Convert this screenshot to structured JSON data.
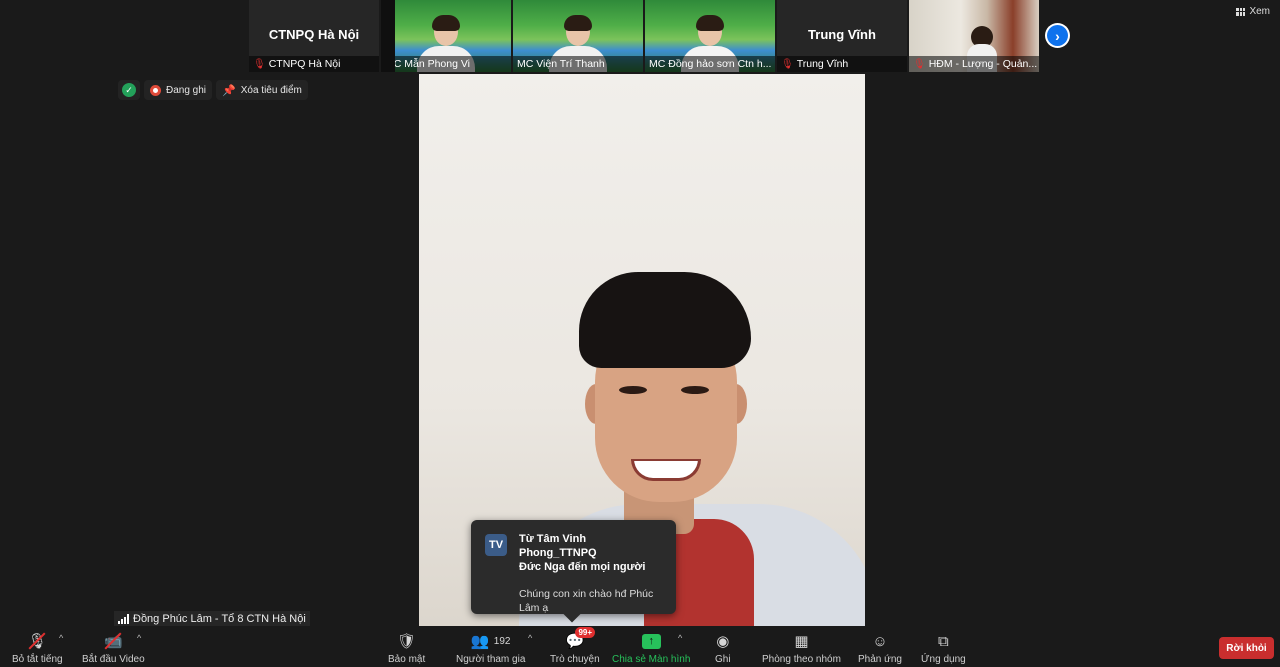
{
  "gallery": {
    "tiles": [
      {
        "type": "name",
        "big_name": "CTNPQ Hà Nội",
        "caption": "CTNPQ Hà Nội",
        "muted": true
      },
      {
        "type": "video",
        "caption": "MC Mẫn Phong Vi",
        "muted": false
      },
      {
        "type": "video",
        "caption": "MC Viện Trí Thanh",
        "muted": false
      },
      {
        "type": "video",
        "caption": "MC Đồng hảo sơn Ctn h...",
        "muted": false
      },
      {
        "type": "name",
        "big_name": "Trung Vĩnh",
        "caption": "Trung Vĩnh",
        "muted": true
      },
      {
        "type": "room",
        "caption": "HĐM - Lượng - Quản...",
        "muted": true
      }
    ],
    "next_icon": "chevron-right-icon"
  },
  "view_button": {
    "label": "Xem",
    "icon": "grid-view-icon"
  },
  "status": {
    "encryption_icon": "shield-check-icon",
    "recording_label": "Đang ghi",
    "unpin_label": "Xóa tiêu điểm"
  },
  "chat_popup": {
    "avatar_initials": "TV",
    "from_line1": "Từ Tâm Vinh Phong_TTNPQ",
    "from_line2": "Đức Nga đến mọi người",
    "message": "Chúng con xin chào hđ Phúc Lâm ạ"
  },
  "speaker_label": "Đồng Phúc Lâm - Tổ 8 CTN Hà Nội",
  "toolbar": {
    "unmute": "Bỏ tắt tiếng",
    "start_video": "Bắt đầu Video",
    "security": "Bảo mật",
    "participants": "Người tham gia",
    "participants_count": "192",
    "chat": "Trò chuyện",
    "chat_badge": "99+",
    "share_screen": "Chia sẻ Màn hình",
    "record": "Ghi",
    "breakout": "Phòng theo nhóm",
    "reactions": "Phản ứng",
    "apps": "Ứng dụng",
    "leave": "Rời khỏi"
  },
  "colors": {
    "background": "#1a1a1a",
    "share_green": "#27c15b",
    "leave_red": "#c92e2e",
    "accent_blue": "#0e72ed"
  }
}
